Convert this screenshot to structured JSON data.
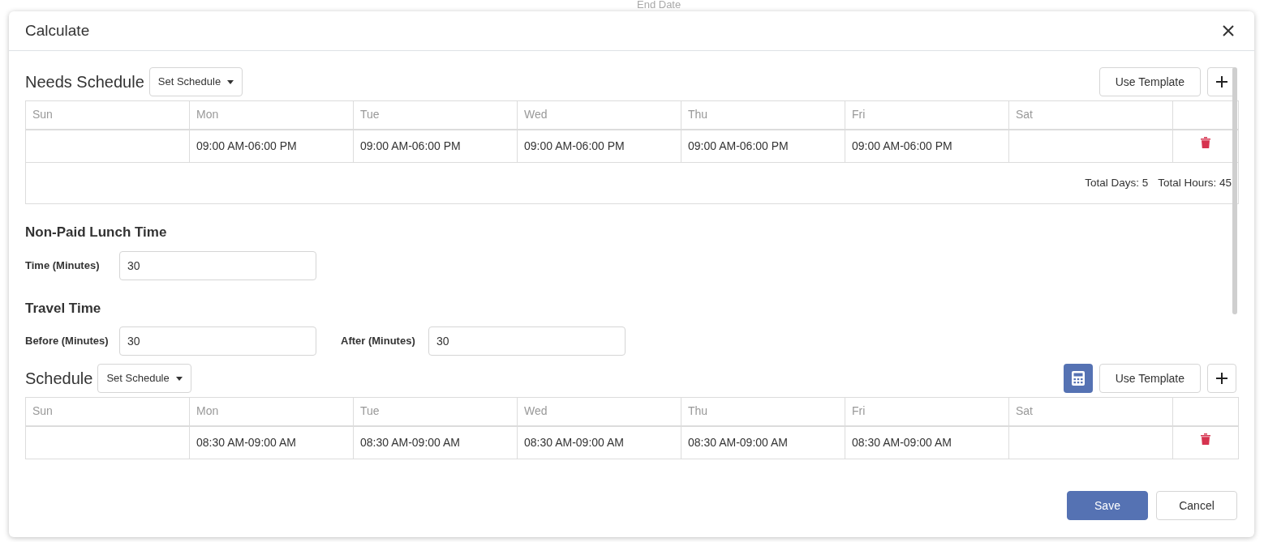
{
  "background": {
    "labels": [
      "End Date"
    ]
  },
  "modal": {
    "title": "Calculate",
    "sections": [
      {
        "kind": "schedule",
        "title": "Needs Schedule",
        "dropdown": "Set Schedule",
        "calculator": false,
        "template_button": "Use Template",
        "columns": [
          "Sun",
          "Mon",
          "Tue",
          "Wed",
          "Thu",
          "Fri",
          "Sat"
        ],
        "rows": [
          {
            "cells": [
              null,
              "09:00 AM-06:00 PM",
              "09:00 AM-06:00 PM",
              "09:00 AM-06:00 PM",
              "09:00 AM-06:00 PM",
              "09:00 AM-06:00 PM",
              null
            ]
          }
        ],
        "totals": [
          "Total Days: 5",
          "Total Hours: 45"
        ]
      },
      {
        "kind": "fields",
        "title": "Non-Paid Lunch Time",
        "fields": [
          {
            "label": "Time (Minutes)",
            "value": "30"
          }
        ]
      },
      {
        "kind": "fields",
        "title": "Travel Time",
        "fields": [
          {
            "label": "Before (Minutes)",
            "value": "30"
          },
          {
            "label": "After (Minutes)",
            "value": "30"
          }
        ]
      },
      {
        "kind": "schedule",
        "title": "Schedule",
        "dropdown": "Set Schedule",
        "calculator": true,
        "template_button": "Use Template",
        "columns": [
          "Sun",
          "Mon",
          "Tue",
          "Wed",
          "Thu",
          "Fri",
          "Sat"
        ],
        "rows": [
          {
            "cells": [
              null,
              "08:30 AM-09:00 AM",
              "08:30 AM-09:00 AM",
              "08:30 AM-09:00 AM",
              "08:30 AM-09:00 AM",
              "08:30 AM-09:00 AM",
              null
            ]
          }
        ]
      }
    ],
    "buttons": [
      {
        "label": "Save",
        "primary": true
      },
      {
        "label": "Cancel",
        "primary": false
      }
    ]
  }
}
